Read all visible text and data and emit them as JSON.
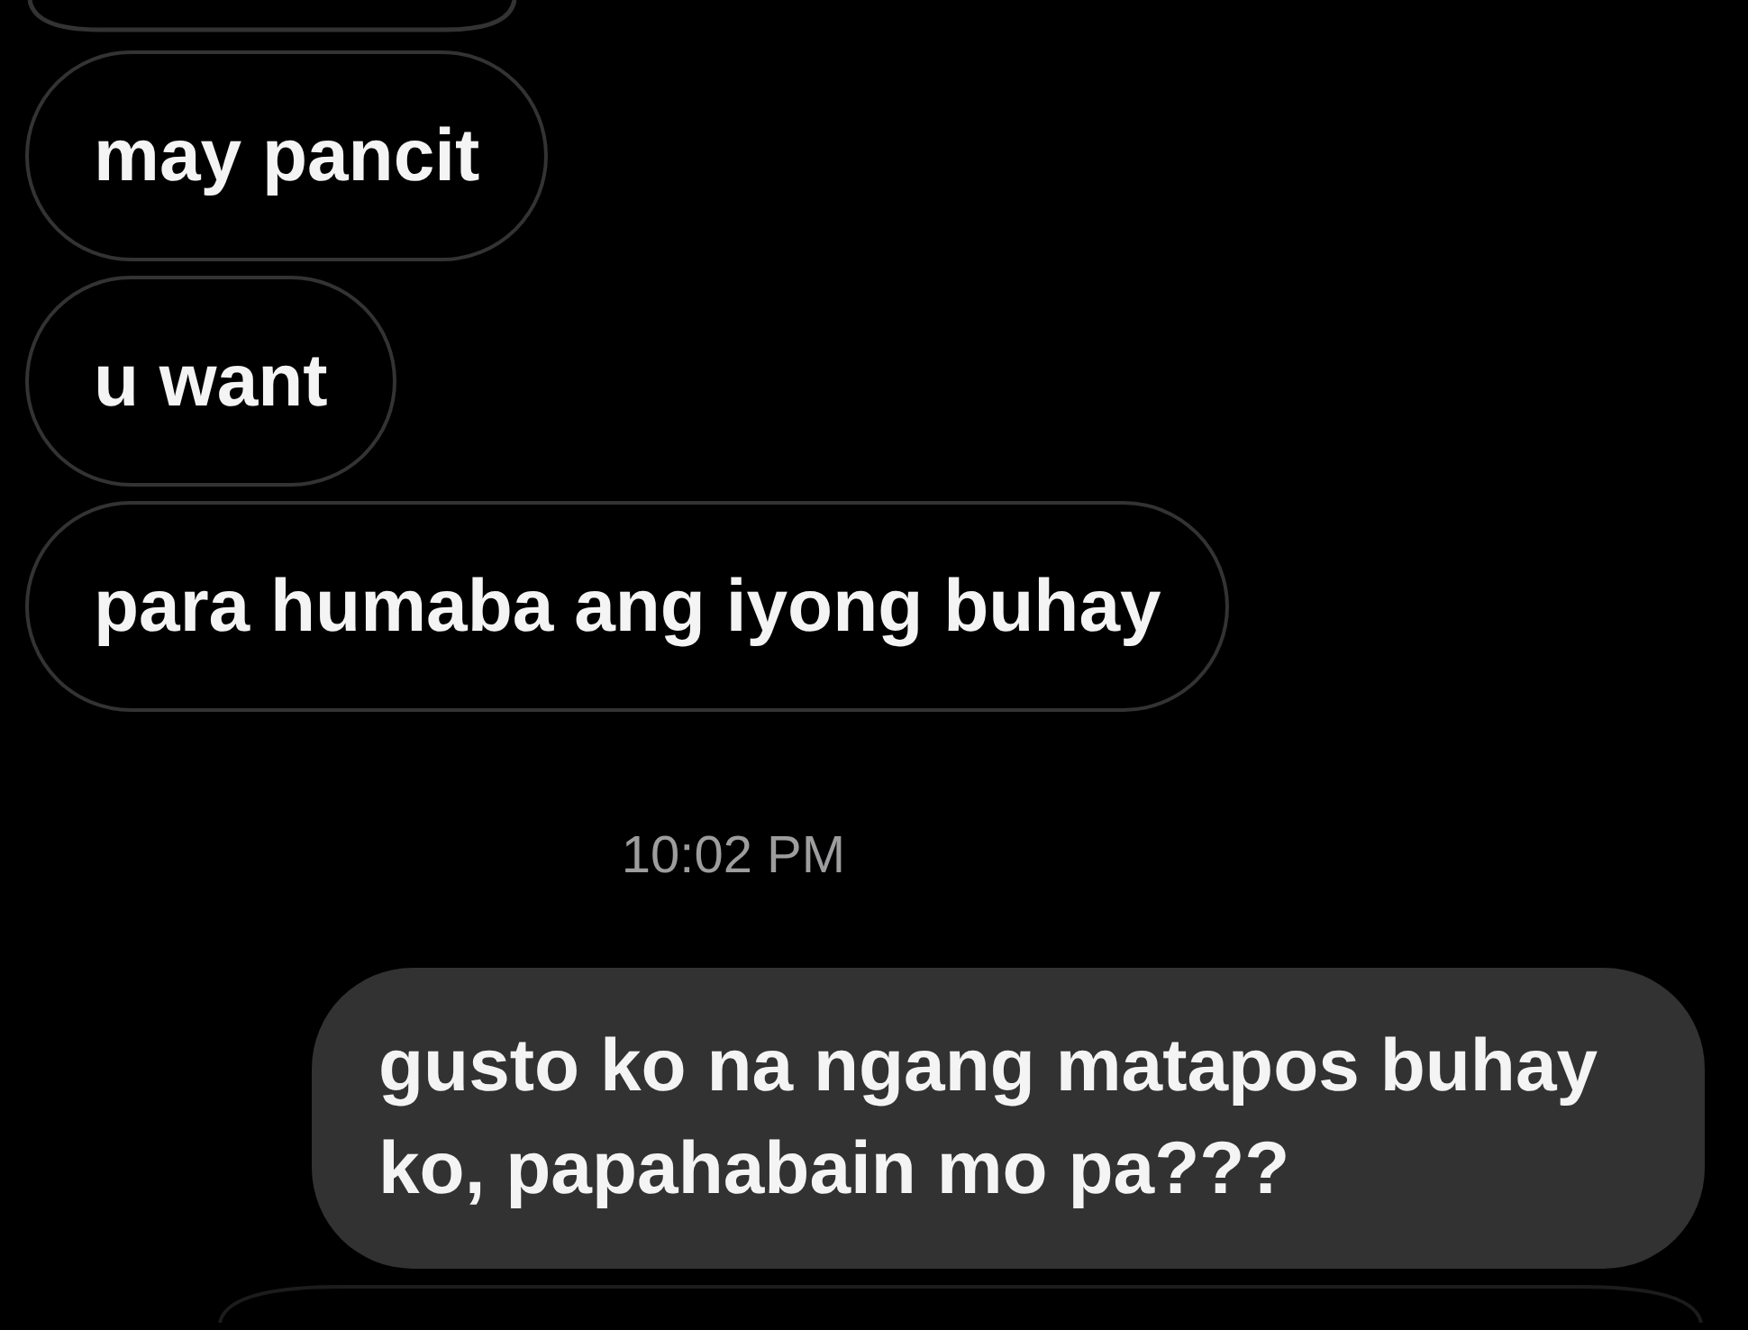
{
  "conversation": {
    "items": [
      {
        "kind": "edge_top"
      },
      {
        "kind": "received",
        "text": "may pancit"
      },
      {
        "kind": "received",
        "text": "u want"
      },
      {
        "kind": "received",
        "text": "para humaba ang iyong buhay"
      },
      {
        "kind": "timestamp",
        "text": "10:02 PM"
      },
      {
        "kind": "sent",
        "text": "gusto ko na ngang matapos buhay ko, papahabain mo pa???"
      },
      {
        "kind": "edge_bottom"
      }
    ]
  }
}
